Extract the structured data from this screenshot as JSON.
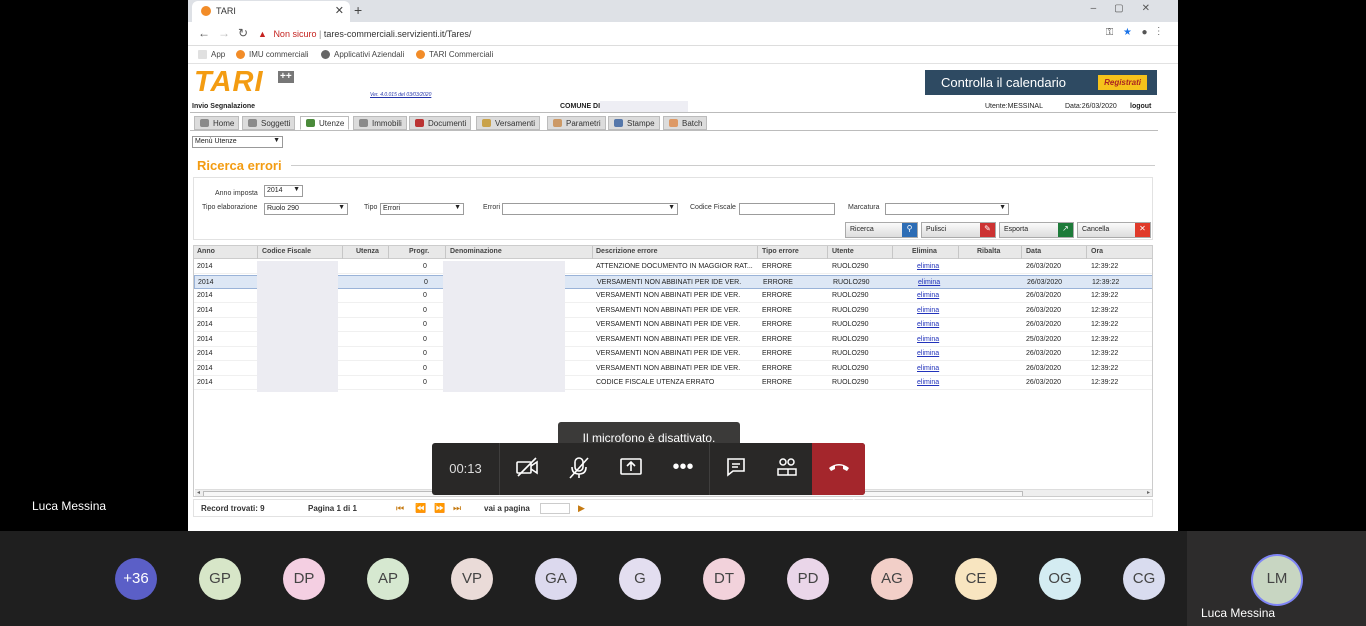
{
  "browser": {
    "tab_title": "TARI",
    "url_warning": "Non sicuro",
    "url": "tares-commerciali.servizienti.it/Tares/",
    "bookmarks": [
      "App",
      "IMU commerciali",
      "Applicativi Aziendali",
      "TARI Commerciali"
    ]
  },
  "app": {
    "logo": "TARI",
    "logo_badge": "++",
    "version": "Ver. 4.0.015 del 03/03/2020",
    "calendar_banner": "Controlla il calendario",
    "register_button": "Registrati",
    "invio_segnalazione": "Invio Segnalazione",
    "comune_label": "COMUNE DI",
    "user_label": "Utente:MESSINAL",
    "date_label": "Data:26/03/2020",
    "logout": "logout",
    "tabs": [
      "Home",
      "Soggetti",
      "Utenze",
      "Immobili",
      "Documenti",
      "Versamenti",
      "Parametri",
      "Stampe",
      "Batch"
    ],
    "active_tab": "Utenze",
    "menu_select": "Menù Utenze",
    "section_title": "Ricerca errori"
  },
  "filters": {
    "anno_label": "Anno imposta",
    "anno_value": "2014",
    "tipo_elab_label": "Tipo elaborazione",
    "tipo_elab_value": "Ruolo 290",
    "tipo_label": "Tipo",
    "tipo_value": "Errori",
    "errori_label": "Errori",
    "errori_value": "",
    "cf_label": "Codice Fiscale",
    "cf_value": "",
    "marcatura_label": "Marcatura",
    "marcatura_value": ""
  },
  "buttons": {
    "ricerca": "Ricerca",
    "pulisci": "Pulisci",
    "esporta": "Esporta",
    "cancella": "Cancella"
  },
  "grid": {
    "headers": [
      "Anno",
      "Codice Fiscale",
      "Utenza",
      "Progr.",
      "Denominazione",
      "Descrizione errore",
      "Tipo errore",
      "Utente",
      "Elimina",
      "Ribalta",
      "Data",
      "Ora"
    ],
    "rows": [
      {
        "anno": "2014",
        "progr": "0",
        "descr": "ATTENZIONE DOCUMENTO IN MAGGIOR RAT...",
        "tipo": "ERRORE",
        "utente": "RUOLO290",
        "elimina": "elimina",
        "data": "26/03/2020",
        "ora": "12:39:22"
      },
      {
        "anno": "2014",
        "progr": "0",
        "descr": "VERSAMENTI NON ABBINATI PER IDE VER.",
        "tipo": "ERRORE",
        "utente": "RUOLO290",
        "elimina": "elimina",
        "data": "26/03/2020",
        "ora": "12:39:22"
      },
      {
        "anno": "2014",
        "progr": "0",
        "descr": "VERSAMENTI NON ABBINATI PER IDE VER.",
        "tipo": "ERRORE",
        "utente": "RUOLO290",
        "elimina": "elimina",
        "data": "26/03/2020",
        "ora": "12:39:22"
      },
      {
        "anno": "2014",
        "progr": "0",
        "descr": "VERSAMENTI NON ABBINATI PER IDE VER.",
        "tipo": "ERRORE",
        "utente": "RUOLO290",
        "elimina": "elimina",
        "data": "26/03/2020",
        "ora": "12:39:22"
      },
      {
        "anno": "2014",
        "progr": "0",
        "descr": "VERSAMENTI NON ABBINATI PER IDE VER.",
        "tipo": "ERRORE",
        "utente": "RUOLO290",
        "elimina": "elimina",
        "data": "26/03/2020",
        "ora": "12:39:22"
      },
      {
        "anno": "2014",
        "progr": "0",
        "descr": "VERSAMENTI NON ABBINATI PER IDE VER.",
        "tipo": "ERRORE",
        "utente": "RUOLO290",
        "elimina": "elimina",
        "data": "25/03/2020",
        "ora": "12:39:22"
      },
      {
        "anno": "2014",
        "progr": "0",
        "descr": "VERSAMENTI NON ABBINATI PER IDE VER.",
        "tipo": "ERRORE",
        "utente": "RUOLO290",
        "elimina": "elimina",
        "data": "26/03/2020",
        "ora": "12:39:22"
      },
      {
        "anno": "2014",
        "progr": "0",
        "descr": "VERSAMENTI NON ABBINATI PER IDE VER.",
        "tipo": "ERRORE",
        "utente": "RUOLO290",
        "elimina": "elimina",
        "data": "26/03/2020",
        "ora": "12:39:22"
      },
      {
        "anno": "2014",
        "progr": "0",
        "descr": "CODICE FISCALE UTENZA ERRATO",
        "tipo": "ERRORE",
        "utente": "RUOLO290",
        "elimina": "elimina",
        "data": "26/03/2020",
        "ora": "12:39:22"
      }
    ]
  },
  "pager": {
    "records": "Record trovati: 9",
    "page": "Pagina 1 di 1",
    "goto": "vai a pagina"
  },
  "call": {
    "toast": "Il microfono è disattivato.",
    "timer": "00:13",
    "presenter_name": "Luca Messina",
    "participants": [
      {
        "initials": "+36",
        "color": "#5b5fc7"
      },
      {
        "initials": "GP",
        "color": "#d7e6c8"
      },
      {
        "initials": "DP",
        "color": "#f4cfe2"
      },
      {
        "initials": "AP",
        "color": "#d6e8d0"
      },
      {
        "initials": "VP",
        "color": "#eadbd8"
      },
      {
        "initials": "GA",
        "color": "#dcd9ee"
      },
      {
        "initials": "G",
        "color": "#e3def0"
      },
      {
        "initials": "DT",
        "color": "#f2d2db"
      },
      {
        "initials": "PD",
        "color": "#ead6e9"
      },
      {
        "initials": "AG",
        "color": "#f2cfc8"
      },
      {
        "initials": "CE",
        "color": "#f8e5c0"
      },
      {
        "initials": "OG",
        "color": "#d4ecf2"
      },
      {
        "initials": "CG",
        "color": "#d9dcef"
      }
    ],
    "self_initials": "LM",
    "self_name": "Luca Messina"
  }
}
